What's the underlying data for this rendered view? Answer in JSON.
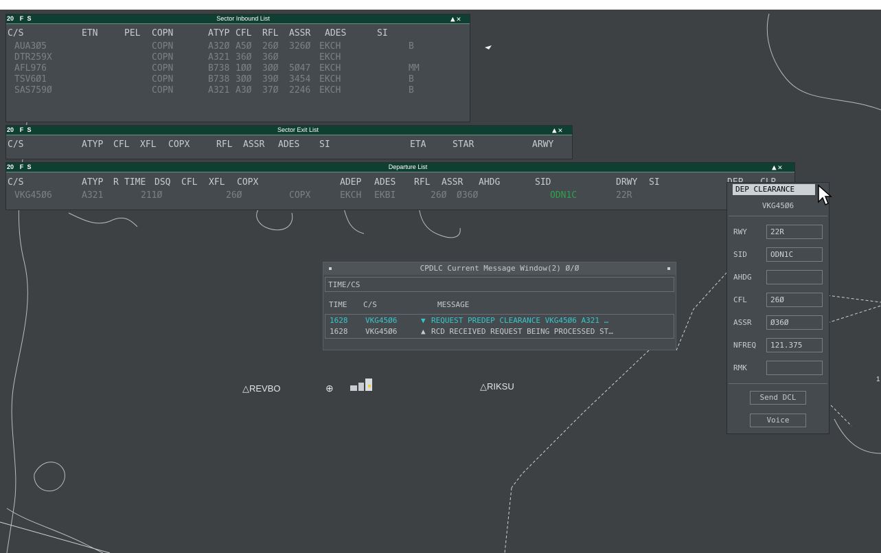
{
  "title_buttons": {
    "level": "20",
    "f": "F",
    "s": "S",
    "up": "▲",
    "close": "✕"
  },
  "inbound": {
    "title": "Sector Inbound List",
    "headers": [
      "C/S",
      "ETN",
      "PEL",
      "COPN",
      "ATYP",
      "CFL",
      "RFL",
      "ASSR",
      "ADES",
      "SI"
    ],
    "rows": [
      [
        "AUA3Ø5",
        "",
        "",
        "COPN",
        "A32Ø",
        "A5Ø",
        "26Ø",
        "326Ø",
        "EKCH",
        "B"
      ],
      [
        "DTR259X",
        "",
        "",
        "COPN",
        "A321",
        "36Ø",
        "36Ø",
        "",
        "EKCH",
        ""
      ],
      [
        "AFL976",
        "",
        "",
        "COPN",
        "B738",
        "1ØØ",
        "3ØØ",
        "5Ø47",
        "EKCH",
        "MM"
      ],
      [
        "TSV6Ø1",
        "",
        "",
        "COPN",
        "B738",
        "3ØØ",
        "39Ø",
        "3454",
        "EKCH",
        "B"
      ],
      [
        "SAS759Ø",
        "",
        "",
        "COPN",
        "A321",
        "A3Ø",
        "37Ø",
        "2246",
        "EKCH",
        "B"
      ]
    ]
  },
  "exit": {
    "title": "Sector Exit List",
    "headers": [
      "C/S",
      "ATYP",
      "CFL",
      "XFL",
      "COPX",
      "RFL",
      "ASSR",
      "ADES",
      "SI",
      "ETA",
      "STAR",
      "ARWY"
    ]
  },
  "departure": {
    "title": "Departure List",
    "headers": [
      "C/S",
      "ATYP",
      "R",
      "TIME",
      "DSQ",
      "CFL",
      "XFL",
      "COPX",
      "ADEP",
      "ADES",
      "RFL",
      "ASSR",
      "AHDG",
      "SID",
      "DRWY",
      "SI",
      "DEP",
      "CLR"
    ],
    "row": [
      "VKG45Ø6",
      "A321",
      "",
      "211Ø",
      "",
      "26Ø",
      "",
      "COPX",
      "EKCH",
      "EKBI",
      "26Ø",
      "Ø36Ø",
      "",
      "ODN1C",
      "22R"
    ]
  },
  "cpdlc": {
    "title": "CPDLC Current Message Window(2) Ø/Ø",
    "subheader": "TIME/CS",
    "columns": [
      "TIME",
      "C/S",
      "MESSAGE"
    ],
    "messages": [
      {
        "time": "1628",
        "cs": "VKG45Ø6",
        "arrow": "▼",
        "text": "REQUEST PREDEP CLEARANCE  VKG45Ø6 A321 …",
        "color": "#39c6c9"
      },
      {
        "time": "1628",
        "cs": "VKG45Ø6",
        "arrow": "▲",
        "text": "RCD RECEIVED REQUEST BEING PROCESSED ST…",
        "color": "#c6cacd"
      }
    ]
  },
  "dep_clearance": {
    "title": "DEP CLEARANCE",
    "callsign": "VKG45Ø6",
    "fields": [
      {
        "label": "RWY",
        "value": "22R"
      },
      {
        "label": "SID",
        "value": "ODN1C"
      },
      {
        "label": "AHDG",
        "value": ""
      },
      {
        "label": "CFL",
        "value": "26Ø"
      },
      {
        "label": "ASSR",
        "value": "Ø36Ø"
      },
      {
        "label": "NFREQ",
        "value": "121.375"
      },
      {
        "label": "RMK",
        "value": ""
      }
    ],
    "send_label": "Send DCL",
    "voice_label": "Voice"
  },
  "map": {
    "fix1": "REVBO",
    "fix2": "RIKSU",
    "fix_glyph": "△",
    "airport_glyph": "⊕",
    "edge_label": "1"
  },
  "colors": {
    "list_header": "#c8ccd0",
    "list_row": "#7c8185",
    "sid_green": "#2fa24a",
    "uplink_cyan": "#39c6c9"
  }
}
